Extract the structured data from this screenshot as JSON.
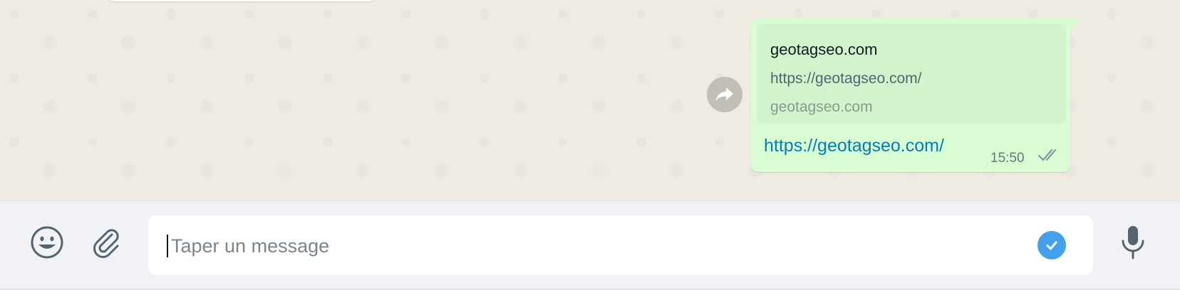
{
  "message": {
    "preview": {
      "title": "geotagseo.com",
      "description": "https://geotagseo.com/",
      "domain": "geotagseo.com"
    },
    "link_text": "https://geotagseo.com/",
    "time": "15:50",
    "status_icon": "double-check-icon"
  },
  "composer": {
    "placeholder": "Taper un message",
    "value": "",
    "icons": [
      "smiley-icon",
      "paperclip-icon",
      "check-circle-icon",
      "microphone-icon"
    ]
  },
  "colors": {
    "chat_background": "#efeae2",
    "outgoing_bubble": "#d9fdd3",
    "link": "#027eb5",
    "composer_background": "#f0f2f5",
    "check_badge": "#43a0ec"
  }
}
